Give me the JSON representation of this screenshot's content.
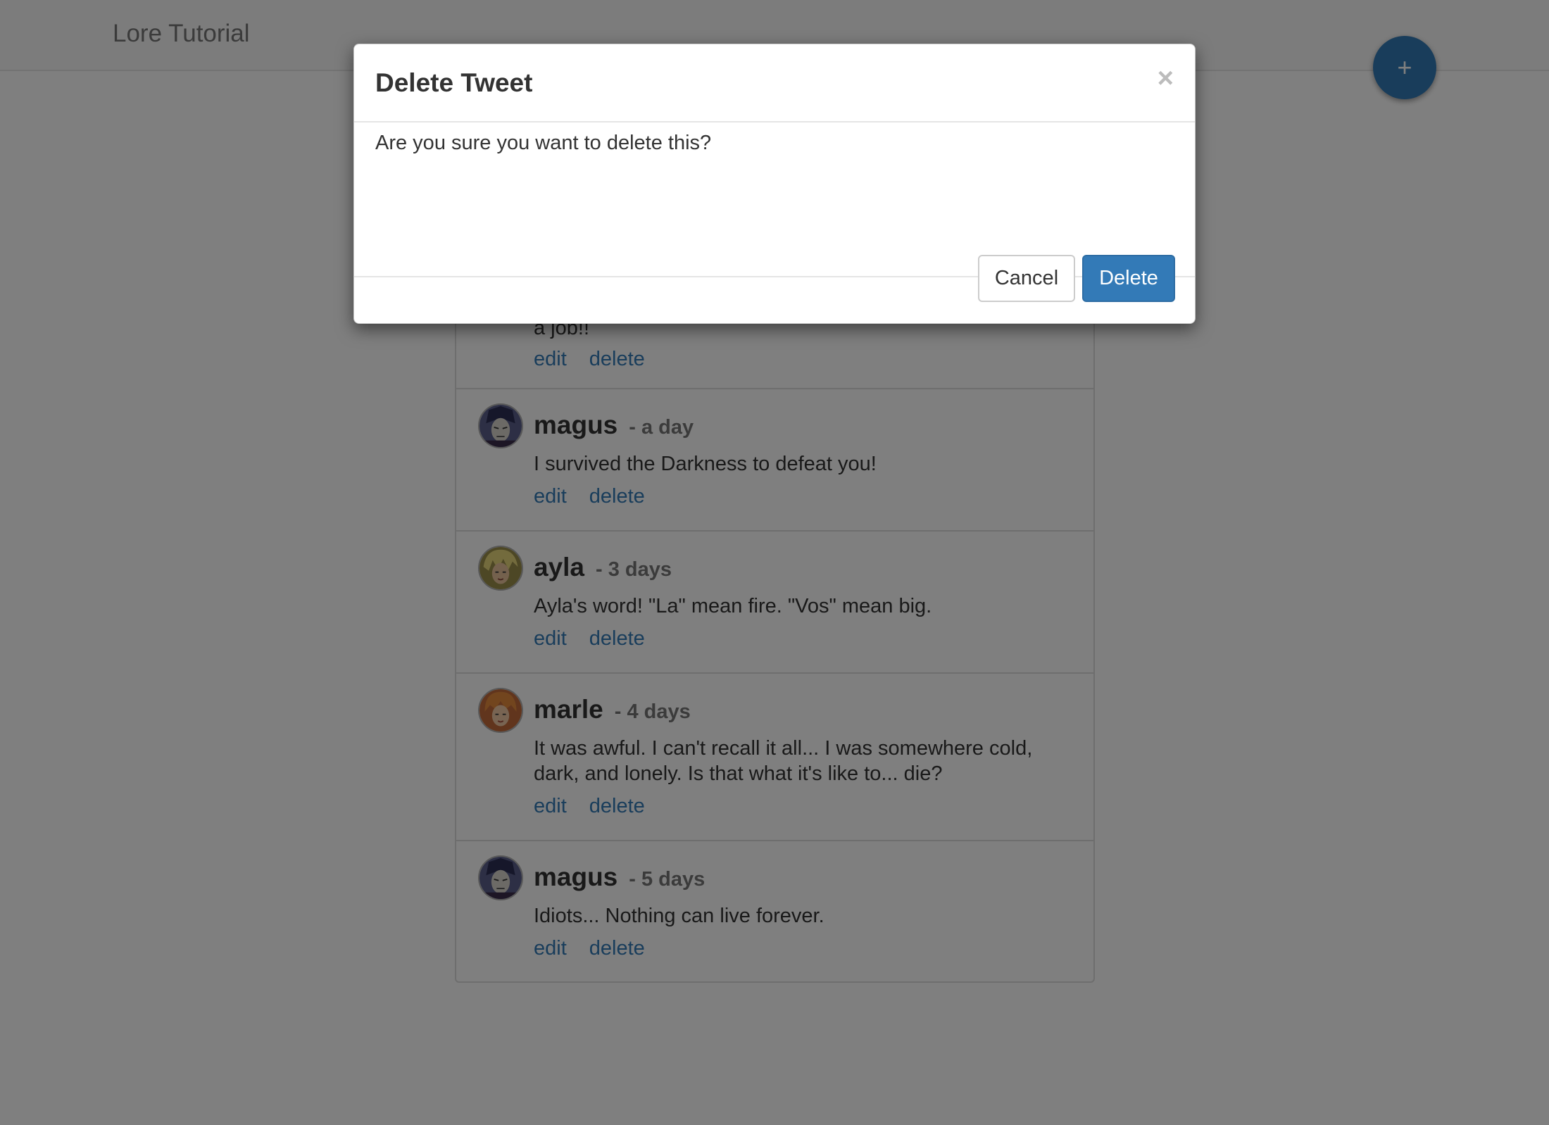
{
  "navbar": {
    "brand": "Lore Tutorial"
  },
  "fab": {
    "label": "+"
  },
  "tweets": [
    {
      "text_partial": "a job!!",
      "edit": "edit",
      "delete": "delete"
    },
    {
      "username": "magus",
      "time": "- a day",
      "text": "I survived the Darkness to defeat you!",
      "edit": "edit",
      "delete": "delete",
      "avatar": "magus-avatar"
    },
    {
      "username": "ayla",
      "time": "- 3 days",
      "text": "Ayla's word! \"La\" mean fire. \"Vos\" mean big.",
      "edit": "edit",
      "delete": "delete",
      "avatar": "ayla-avatar"
    },
    {
      "username": "marle",
      "time": "- 4 days",
      "text": "It was awful. I can't recall it all... I was somewhere cold, dark, and lonely. Is that what it's like to... die?",
      "edit": "edit",
      "delete": "delete",
      "avatar": "marle-avatar"
    },
    {
      "username": "magus",
      "time": "- 5 days",
      "text": "Idiots... Nothing can live forever.",
      "edit": "edit",
      "delete": "delete",
      "avatar": "magus-avatar"
    }
  ],
  "modal": {
    "title": "Delete Tweet",
    "close": "×",
    "body": "Are you sure you want to delete this?",
    "cancel_label": "Cancel",
    "delete_label": "Delete"
  },
  "colors": {
    "primary": "#337ab7",
    "link": "#337ab7",
    "muted": "#777777",
    "backdrop": "rgba(0,0,0,0.5)"
  }
}
